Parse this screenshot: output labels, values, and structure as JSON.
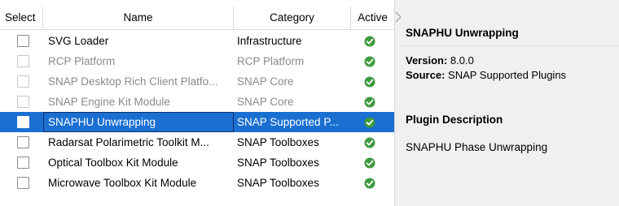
{
  "table": {
    "columns": {
      "select": "Select",
      "name": "Name",
      "category": "Category",
      "active": "Active"
    },
    "rows": [
      {
        "name": "SVG Loader",
        "category": "Infrastructure",
        "enabled": true,
        "selected": false,
        "active": true
      },
      {
        "name": "RCP Platform",
        "category": "RCP Platform",
        "enabled": false,
        "selected": false,
        "active": true
      },
      {
        "name": "SNAP Desktop Rich Client Platfo...",
        "category": "SNAP Core",
        "enabled": false,
        "selected": false,
        "active": true
      },
      {
        "name": "SNAP Engine Kit Module",
        "category": "SNAP Core",
        "enabled": false,
        "selected": false,
        "active": true
      },
      {
        "name": "SNAPHU Unwrapping",
        "category": "SNAP Supported P...",
        "enabled": true,
        "selected": true,
        "active": true
      },
      {
        "name": "Radarsat Polarimetric Toolkit M...",
        "category": "SNAP Toolboxes",
        "enabled": true,
        "selected": false,
        "active": true
      },
      {
        "name": "Optical Toolbox Kit Module",
        "category": "SNAP Toolboxes",
        "enabled": true,
        "selected": false,
        "active": true
      },
      {
        "name": "Microwave Toolbox Kit Module",
        "category": "SNAP Toolboxes",
        "enabled": true,
        "selected": false,
        "active": true
      }
    ],
    "active_icon": "green-check-circle-icon"
  },
  "details": {
    "title": "SNAPHU Unwrapping",
    "version_label": "Version:",
    "version_value": "8.0.0",
    "source_label": "Source:",
    "source_value": "SNAP Supported Plugins",
    "description_heading": "Plugin Description",
    "description_text": "SNAPHU Phase Unwrapping"
  },
  "colors": {
    "selection": "#1a6fd1",
    "active_check": "#3f9a3f",
    "disabled_text": "#8a8a8a",
    "detail_background": "#f0f0f0"
  }
}
